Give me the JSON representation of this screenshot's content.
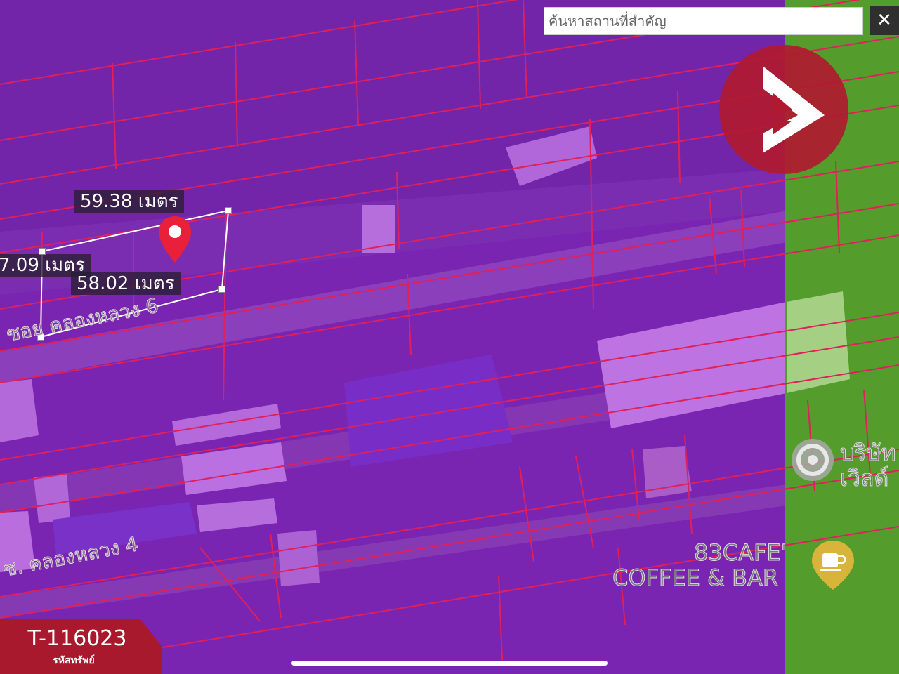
{
  "search": {
    "placeholder": "ค้นหาสถานที่สำคัญ"
  },
  "close": {
    "label": "✕"
  },
  "measurements": {
    "top": "59.38 เมตร",
    "left": "7.09 เมตร",
    "bottom": "58.02 เมตร"
  },
  "roads": {
    "road_6": "ซอย คลองหลวง 6",
    "road_4": "ซ. คลองหลวง 4"
  },
  "pois": {
    "company": "บริษัท\nเวิลด์",
    "company_line1": "บริษัท",
    "company_line2": "เวิลด์",
    "cafe_line1": "83CAFE'",
    "cafe_line2": "COFFEE & BAR"
  },
  "badge": {
    "code": "T-116023",
    "label": "รหัสทรัพย์"
  },
  "colors": {
    "overlay_purple": "#8b1fd0",
    "overlay_green": "#5db82e",
    "parcel_lines": "#e0205a",
    "badge": "#a8192e",
    "logo": "#b01a30"
  },
  "icons": {
    "pin": "map-pin-icon",
    "close": "close-icon",
    "logo": "brand-logo",
    "cafe": "coffee-cup-icon",
    "company": "place-icon"
  }
}
